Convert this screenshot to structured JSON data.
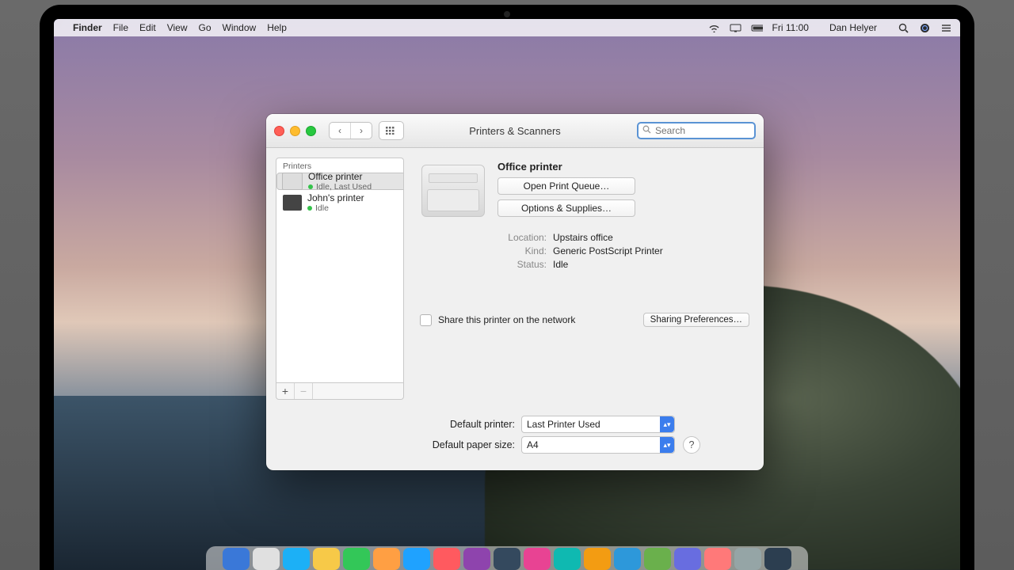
{
  "menubar": {
    "app": "Finder",
    "items": [
      "File",
      "Edit",
      "View",
      "Go",
      "Window",
      "Help"
    ],
    "time": "Fri 11:00",
    "user": "Dan Helyer"
  },
  "window": {
    "title": "Printers & Scanners",
    "search_placeholder": "Search"
  },
  "sidebar": {
    "header": "Printers",
    "items": [
      {
        "name": "Office printer",
        "status": "Idle, Last Used"
      },
      {
        "name": "John's printer",
        "status": "Idle"
      }
    ],
    "add": "+",
    "remove": "−"
  },
  "detail": {
    "name": "Office printer",
    "open_queue": "Open Print Queue…",
    "options": "Options & Supplies…",
    "labels": {
      "location": "Location:",
      "kind": "Kind:",
      "status": "Status:"
    },
    "values": {
      "location": "Upstairs office",
      "kind": "Generic PostScript Printer",
      "status": "Idle"
    },
    "share_label": "Share this printer on the network",
    "sharing_prefs": "Sharing Preferences…"
  },
  "footer": {
    "default_printer_label": "Default printer:",
    "default_printer_value": "Last Printer Used",
    "paper_label": "Default paper size:",
    "paper_value": "A4",
    "help": "?"
  },
  "dock_colors": [
    "#3a78d8",
    "#e0e0e0",
    "#1cb0f6",
    "#f7c948",
    "#33c758",
    "#ff9f43",
    "#1fa2ff",
    "#ff5a5f",
    "#8e44ad",
    "#34495e",
    "#e84393",
    "#0fb9b1",
    "#f39c12",
    "#2d98da",
    "#6ab04c",
    "#686de0",
    "#ff7979",
    "#95a5a6",
    "#2c3e50"
  ]
}
